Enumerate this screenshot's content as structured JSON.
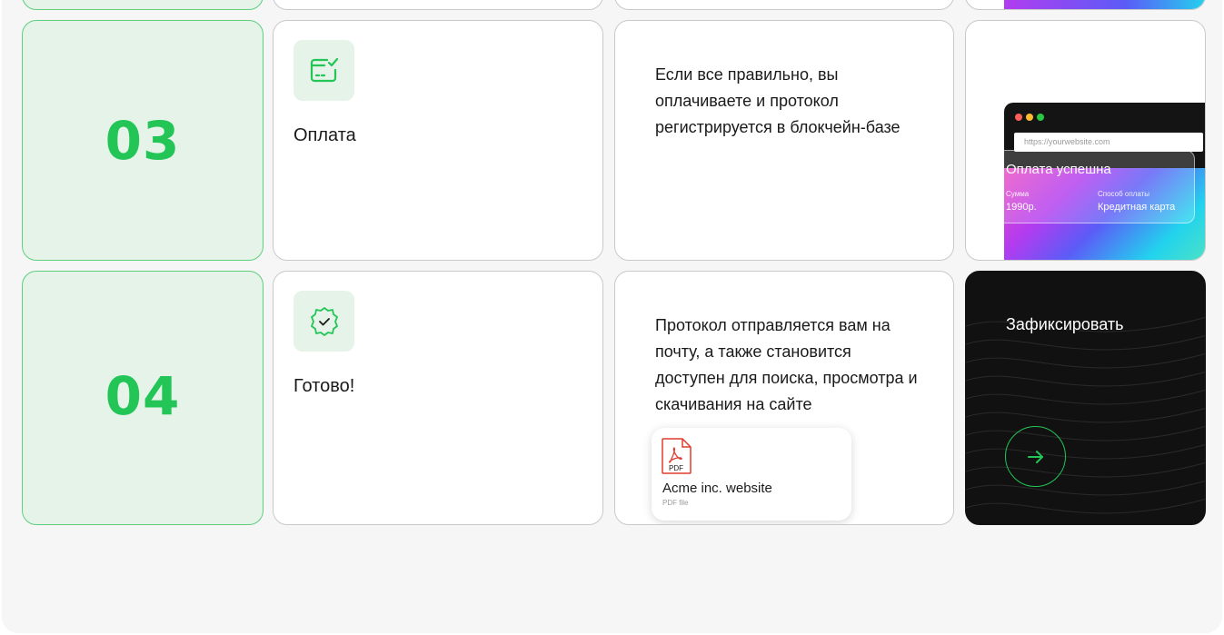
{
  "steps": [
    {
      "number": "03",
      "title": "Оплата",
      "icon": "card-check-icon",
      "description": [
        "Если все правильно, вы",
        "оплачиваете и протокол",
        "регистрируется в блокчейн-базе"
      ],
      "preview": {
        "url": "https://yourwebsite.com",
        "status_title": "Оплата успешна",
        "amount_label": "Сумма",
        "amount_value": "1990р.",
        "method_label": "Способ оплаты",
        "method_value": "Кредитная карта"
      }
    },
    {
      "number": "04",
      "title": "Готово!",
      "icon": "verified-badge-icon",
      "description": [
        "Протокол отправляется вам на",
        "почту, а также становится",
        "доступен для поиска, просмотра и",
        "скачивания на сайте"
      ],
      "file": {
        "badge": "PDF",
        "name": "Acme inc. website",
        "type": "PDF file"
      }
    }
  ],
  "cta": {
    "label": "Зафиксировать",
    "icon": "arrow-right-icon"
  },
  "colors": {
    "accent": "#22c556",
    "accent_bg": "#e5f3e9",
    "dark": "#111111"
  }
}
